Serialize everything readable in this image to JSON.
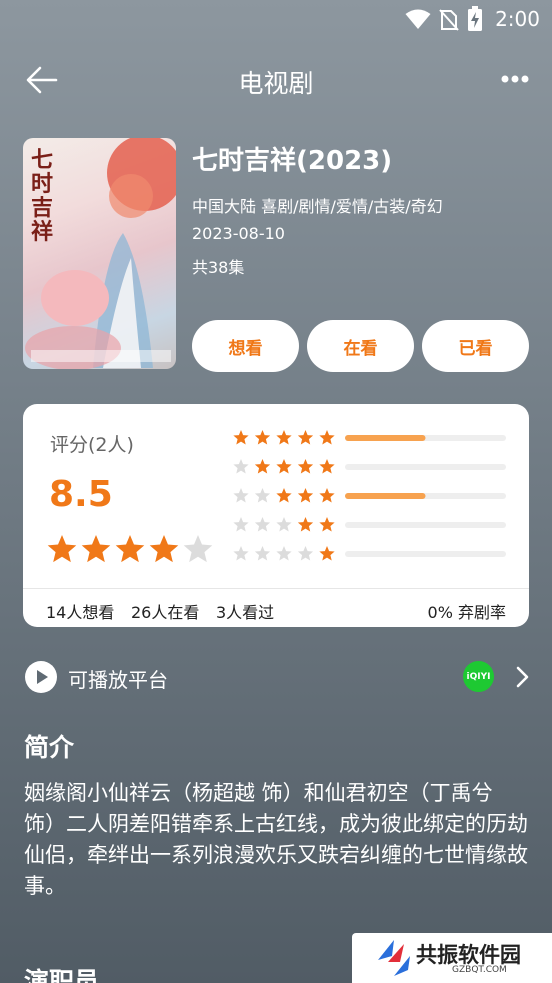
{
  "status": {
    "time": "2:00"
  },
  "header": {
    "title": "电视剧",
    "back_icon": "back-arrow-icon",
    "more_icon": "more-dots-icon"
  },
  "show": {
    "title": "七时吉祥(2023)",
    "region_genres": "中国大陆  喜剧/剧情/爱情/古装/奇幻",
    "date": "2023-08-10",
    "episodes": "共38集",
    "poster_text": "七时吉祥"
  },
  "actions": {
    "want": "想看",
    "watching": "在看",
    "watched": "已看"
  },
  "rating": {
    "label": "评分(2人)",
    "score": "8.5",
    "stars": 4,
    "distribution": [
      {
        "stars": 5,
        "fraction": 0.5
      },
      {
        "stars": 4,
        "fraction": 0
      },
      {
        "stars": 3,
        "fraction": 0.5
      },
      {
        "stars": 2,
        "fraction": 0
      },
      {
        "stars": 1,
        "fraction": 0
      }
    ],
    "want_count": "14人想看",
    "watching_count": "26人在看",
    "watched_count": "3人看过",
    "drop_rate": "0% 弃剧率"
  },
  "platform": {
    "label": "可播放平台",
    "logo_text": "iQIYI"
  },
  "intro": {
    "heading": "简介",
    "text": "姻缘阁小仙祥云（杨超越 饰）和仙君初空（丁禹兮 饰）二人阴差阳错牵系上古红线，成为彼此绑定的历劫仙侣，牵绊出一系列浪漫欢乐又跌宕纠缠的七世情缘故事。"
  },
  "cast": {
    "heading": "演职员"
  },
  "watermark": {
    "name": "共振软件园",
    "url": "GZBQT.COM"
  },
  "colors": {
    "accent": "#f07818",
    "star_empty": "#dcdcdc",
    "bar_empty": "#eeeeee",
    "iqiyi": "#1ec932"
  }
}
